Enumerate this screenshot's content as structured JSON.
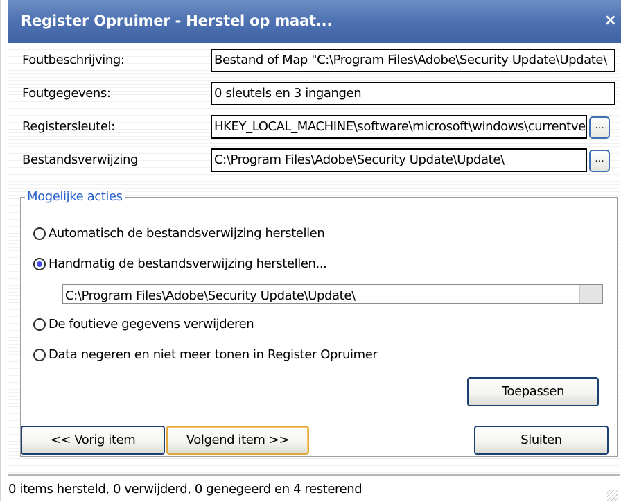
{
  "window": {
    "title": "Register Opruimer - Herstel op maat...",
    "close_glyph": "×"
  },
  "fields": {
    "description": {
      "label": "Foutbeschrijving:",
      "value": "Bestand of Map \"C:\\Program Files\\Adobe\\Security Update\\Update\\"
    },
    "details": {
      "label": "Foutgegevens:",
      "value": "0 sleutels en 3 ingangen"
    },
    "registry_key": {
      "label": "Registersleutel:",
      "value": "HKEY_LOCAL_MACHINE\\software\\microsoft\\windows\\currentversion\\uninstall",
      "button": "..."
    },
    "file_reference": {
      "label": "Bestandsverwijzing",
      "value": "C:\\Program Files\\Adobe\\Security Update\\Update\\",
      "button": "..."
    }
  },
  "actions": {
    "title": "Mogelijke acties",
    "options": [
      {
        "label": "Automatisch de bestandsverwijzing herstellen",
        "checked": false
      },
      {
        "label": "Handmatig de bestandsverwijzing herstellen...",
        "checked": true
      },
      {
        "label": "De foutieve gegevens verwijderen",
        "checked": false
      },
      {
        "label": "Data negeren en niet meer tonen in Register Opruimer",
        "checked": false
      }
    ],
    "manual_path": "C:\\Program Files\\Adobe\\Security Update\\Update\\",
    "apply_button": "Toepassen"
  },
  "nav": {
    "prev": "<< Vorig item",
    "next": "Volgend item >>",
    "close": "Sluiten"
  },
  "status": {
    "text": "0 items hersteld, 0 verwijderd, 0 genegeerd en 4 resterend"
  }
}
